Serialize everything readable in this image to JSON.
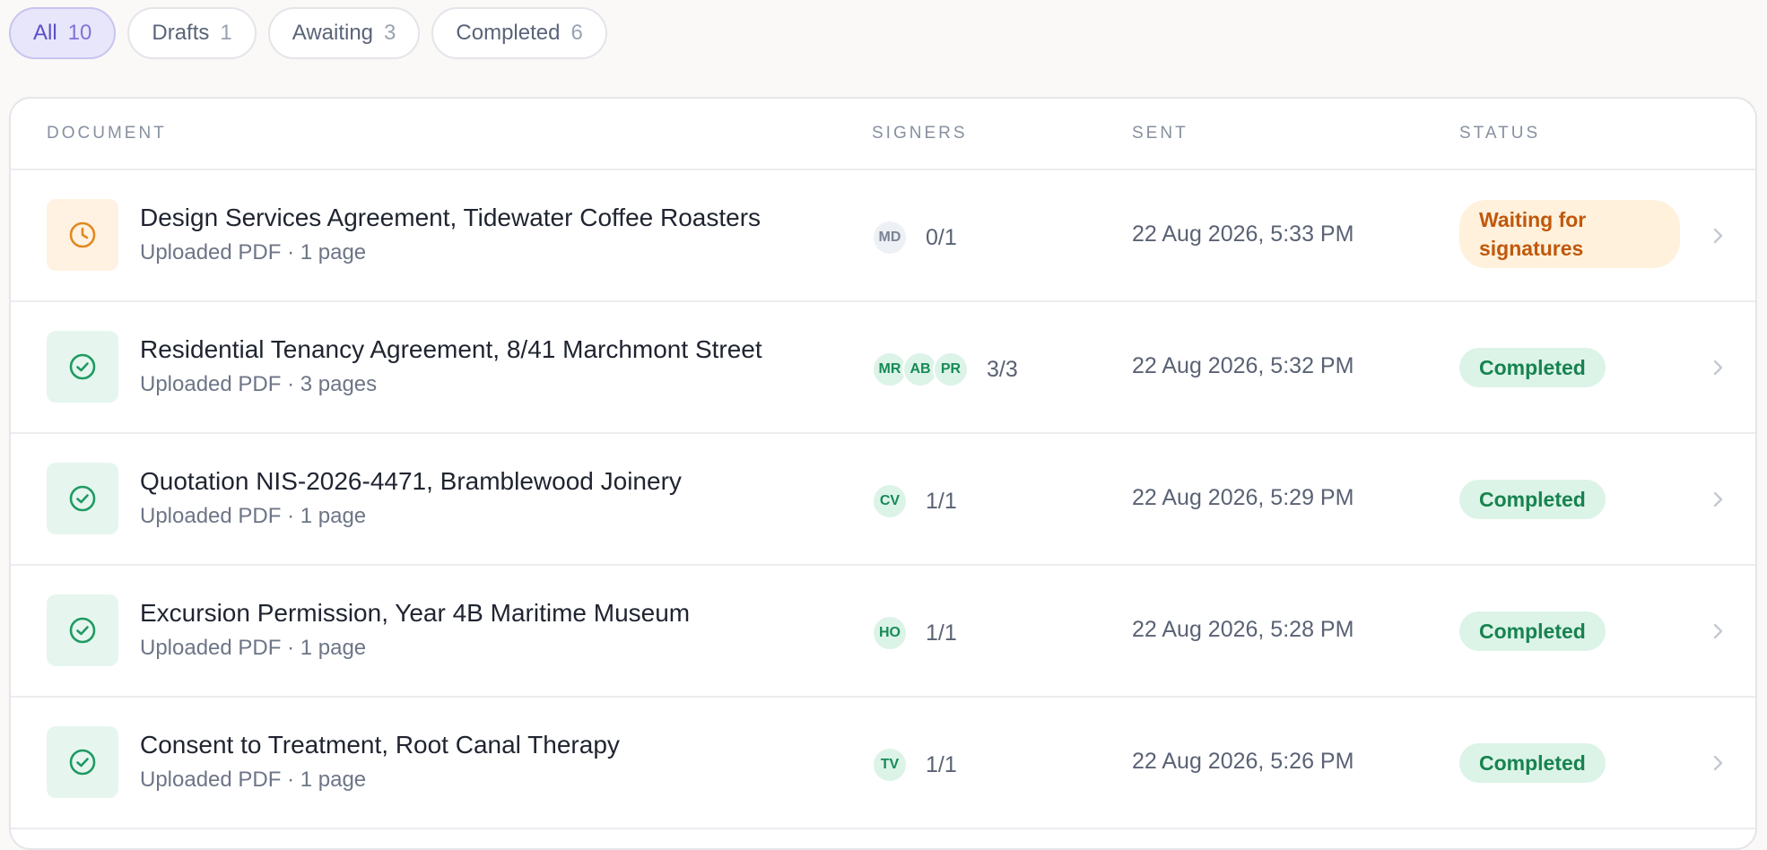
{
  "filters": [
    {
      "label": "All",
      "count": "10"
    },
    {
      "label": "Drafts",
      "count": "1"
    },
    {
      "label": "Awaiting",
      "count": "3"
    },
    {
      "label": "Completed",
      "count": "6"
    }
  ],
  "table": {
    "headers": {
      "document": "DOCUMENT",
      "signers": "SIGNERS",
      "sent": "SENT",
      "status": "STATUS"
    },
    "rows": [
      {
        "title": "Design Services Agreement, Tidewater Coffee Roasters",
        "meta": "Uploaded PDF · 1 page",
        "signers": [
          "MD"
        ],
        "signed": "0/1",
        "sent": "22 Aug 2026, 5:33 PM",
        "status": "Waiting for signatures",
        "icon": "clock-icon"
      },
      {
        "title": "Residential Tenancy Agreement, 8/41 Marchmont Street",
        "meta": "Uploaded PDF · 3 pages",
        "signers": [
          "MR",
          "AB",
          "PR"
        ],
        "signed": "3/3",
        "sent": "22 Aug 2026, 5:32 PM",
        "status": "Completed",
        "icon": "check-circle-icon"
      },
      {
        "title": "Quotation NIS-2026-4471, Bramblewood Joinery",
        "meta": "Uploaded PDF · 1 page",
        "signers": [
          "CV"
        ],
        "signed": "1/1",
        "sent": "22 Aug 2026, 5:29 PM",
        "status": "Completed",
        "icon": "check-circle-icon"
      },
      {
        "title": "Excursion Permission, Year 4B Maritime Museum",
        "meta": "Uploaded PDF · 1 page",
        "signers": [
          "HO"
        ],
        "signed": "1/1",
        "sent": "22 Aug 2026, 5:28 PM",
        "status": "Completed",
        "icon": "check-circle-icon"
      },
      {
        "title": "Consent to Treatment, Root Canal Therapy",
        "meta": "Uploaded PDF · 1 page",
        "signers": [
          "TV"
        ],
        "signed": "1/1",
        "sent": "22 Aug 2026, 5:26 PM",
        "status": "Completed",
        "icon": "check-circle-icon"
      }
    ]
  },
  "colors": {
    "accent": "#5a4fc4",
    "waiting": "#c0580c",
    "completed": "#17834f"
  }
}
